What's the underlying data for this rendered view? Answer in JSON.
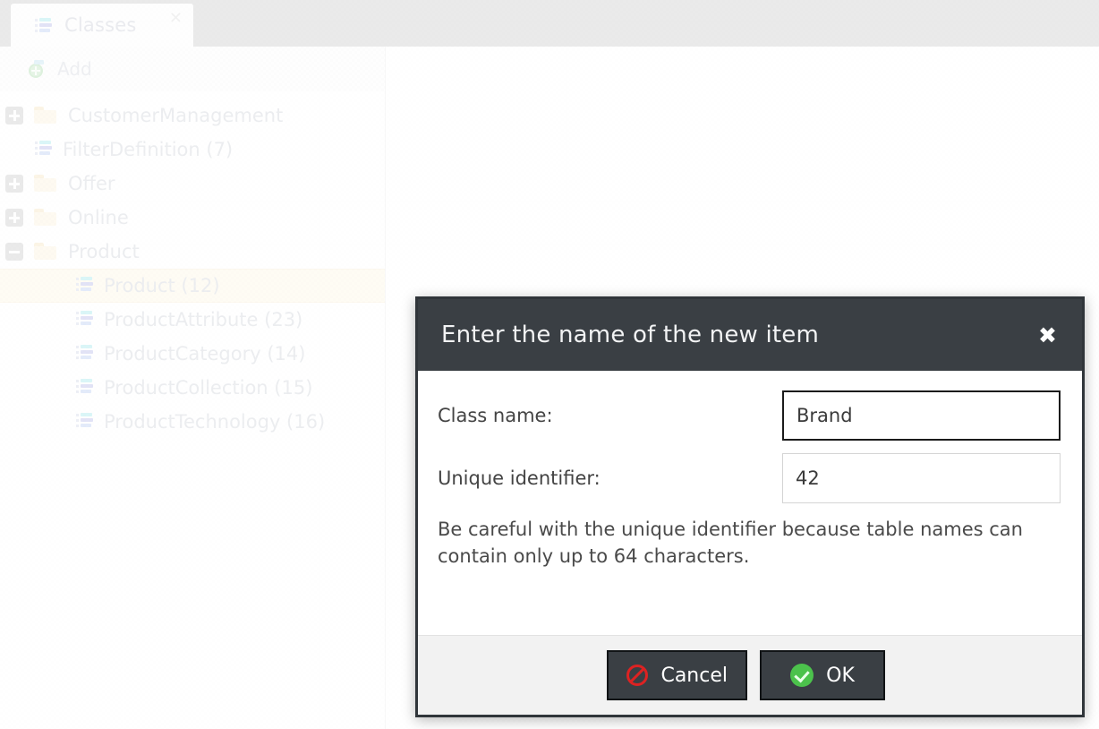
{
  "tabs": [
    {
      "label": "Classes",
      "icon": "class-list-icon",
      "close_label": "✕"
    }
  ],
  "toolbar": {
    "add_label": "Add",
    "add_icon": "add-icon"
  },
  "tree": {
    "items": [
      {
        "label": "CustomerManagement",
        "toggle": "plus",
        "icon": "folder-icon",
        "level": 0,
        "selected": false
      },
      {
        "label": "FilterDefinition (7)",
        "toggle": "none",
        "icon": "class-list-icon",
        "level": 0,
        "selected": false
      },
      {
        "label": "Offer",
        "toggle": "plus",
        "icon": "folder-icon",
        "level": 0,
        "selected": false
      },
      {
        "label": "Online",
        "toggle": "plus",
        "icon": "folder-icon",
        "level": 0,
        "selected": false
      },
      {
        "label": "Product",
        "toggle": "minus",
        "icon": "folder-icon",
        "level": 0,
        "selected": false
      },
      {
        "label": "Product (12)",
        "toggle": "none",
        "icon": "class-list-icon",
        "level": 1,
        "selected": true
      },
      {
        "label": "ProductAttribute (23)",
        "toggle": "none",
        "icon": "class-list-icon",
        "level": 1,
        "selected": false
      },
      {
        "label": "ProductCategory (14)",
        "toggle": "none",
        "icon": "class-list-icon",
        "level": 1,
        "selected": false
      },
      {
        "label": "ProductCollection (15)",
        "toggle": "none",
        "icon": "class-list-icon",
        "level": 1,
        "selected": false
      },
      {
        "label": "ProductTechnology (16)",
        "toggle": "none",
        "icon": "class-list-icon",
        "level": 1,
        "selected": false
      }
    ]
  },
  "dialog": {
    "title": "Enter the name of the new item",
    "close_label": "✖",
    "fields": [
      {
        "label": "Class name:",
        "value": "Brand",
        "placeholder": "",
        "focused": true
      },
      {
        "label": "Unique identifier:",
        "value": "42",
        "placeholder": "",
        "focused": false
      }
    ],
    "hint": "Be careful with the unique identifier because table names can contain only up to 64 characters.",
    "buttons": [
      {
        "label": "Cancel",
        "icon": "cancel-icon"
      },
      {
        "label": "OK",
        "icon": "check-circle-icon"
      }
    ]
  },
  "colors": {
    "tabstrip": "#c9c9c9",
    "dialog_header": "#3a3f44",
    "dialog_border": "#30353a",
    "selection": "#fdf6e3",
    "ok_green": "#4cc24c",
    "cancel_red": "#dd2222",
    "folder": "#fbf1da"
  }
}
